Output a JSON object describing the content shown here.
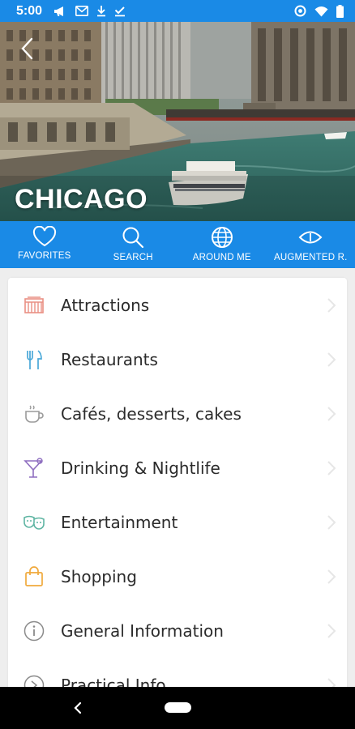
{
  "status_bar": {
    "time": "5:00",
    "left_icons": [
      "megaphone-icon",
      "mail-icon",
      "download-icon",
      "download-done-icon"
    ],
    "right_icons": [
      "data-saver-icon",
      "wifi-icon",
      "battery-icon"
    ]
  },
  "hero": {
    "title": "CHICAGO"
  },
  "nav": [
    {
      "label": "FAVORITES",
      "icon": "heart-icon"
    },
    {
      "label": "SEARCH",
      "icon": "search-icon"
    },
    {
      "label": "AROUND ME",
      "icon": "globe-icon"
    },
    {
      "label": "AUGMENTED R.",
      "icon": "eye-icon"
    }
  ],
  "menu": [
    {
      "label": "Attractions",
      "icon": "attractions-icon",
      "color": "#e98f83"
    },
    {
      "label": "Restaurants",
      "icon": "fork-knife-icon",
      "color": "#4aa8d8"
    },
    {
      "label": "Cafés, desserts, cakes",
      "icon": "coffee-cup-icon",
      "color": "#9a9a9a"
    },
    {
      "label": "Drinking & Nightlife",
      "icon": "cocktail-icon",
      "color": "#8f6fc0"
    },
    {
      "label": "Entertainment",
      "icon": "masks-icon",
      "color": "#5fb5a3"
    },
    {
      "label": "Shopping",
      "icon": "shopping-bag-icon",
      "color": "#f0a93c"
    },
    {
      "label": "General Information",
      "icon": "info-icon",
      "color": "#8a8a8a"
    },
    {
      "label": "Practical Info",
      "icon": "compass-icon",
      "color": "#8a8a8a"
    }
  ],
  "colors": {
    "primary": "#1a8ae6",
    "text": "#2b2b2b",
    "card": "#ffffff",
    "background": "#eeeeee"
  }
}
